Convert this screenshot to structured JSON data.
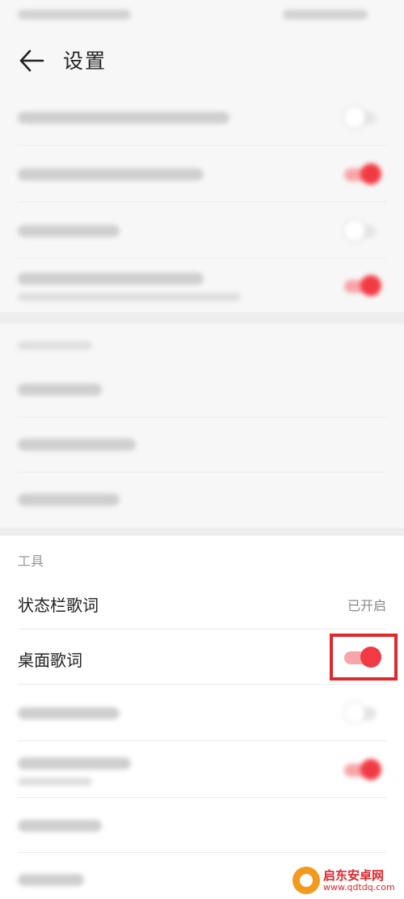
{
  "header": {
    "title": "设置"
  },
  "top_section": {
    "rows": [
      {
        "label": "",
        "toggle": "off"
      },
      {
        "label": "",
        "toggle": "on"
      },
      {
        "label": "",
        "toggle": "off"
      },
      {
        "label": "",
        "subtitle": "",
        "toggle": "on"
      }
    ]
  },
  "account_section": {
    "label": "",
    "rows": [
      {
        "label": ""
      },
      {
        "label": ""
      },
      {
        "label": ""
      }
    ]
  },
  "tools_section": {
    "label": "工具",
    "status_bar_lyrics": {
      "label": "状态栏歌词",
      "value": "已开启"
    },
    "desktop_lyrics": {
      "label": "桌面歌词",
      "toggle": "on"
    }
  },
  "bottom_section": {
    "rows": [
      {
        "label": "",
        "toggle": "off"
      },
      {
        "label": "",
        "subtitle": "",
        "toggle": "on"
      },
      {
        "label": ""
      },
      {
        "label": ""
      }
    ]
  },
  "watermark": {
    "title": "启东安卓网",
    "url": "www.qdtdq.com"
  },
  "colors": {
    "accent": "#f23a44",
    "highlight_box": "#e0272c"
  }
}
